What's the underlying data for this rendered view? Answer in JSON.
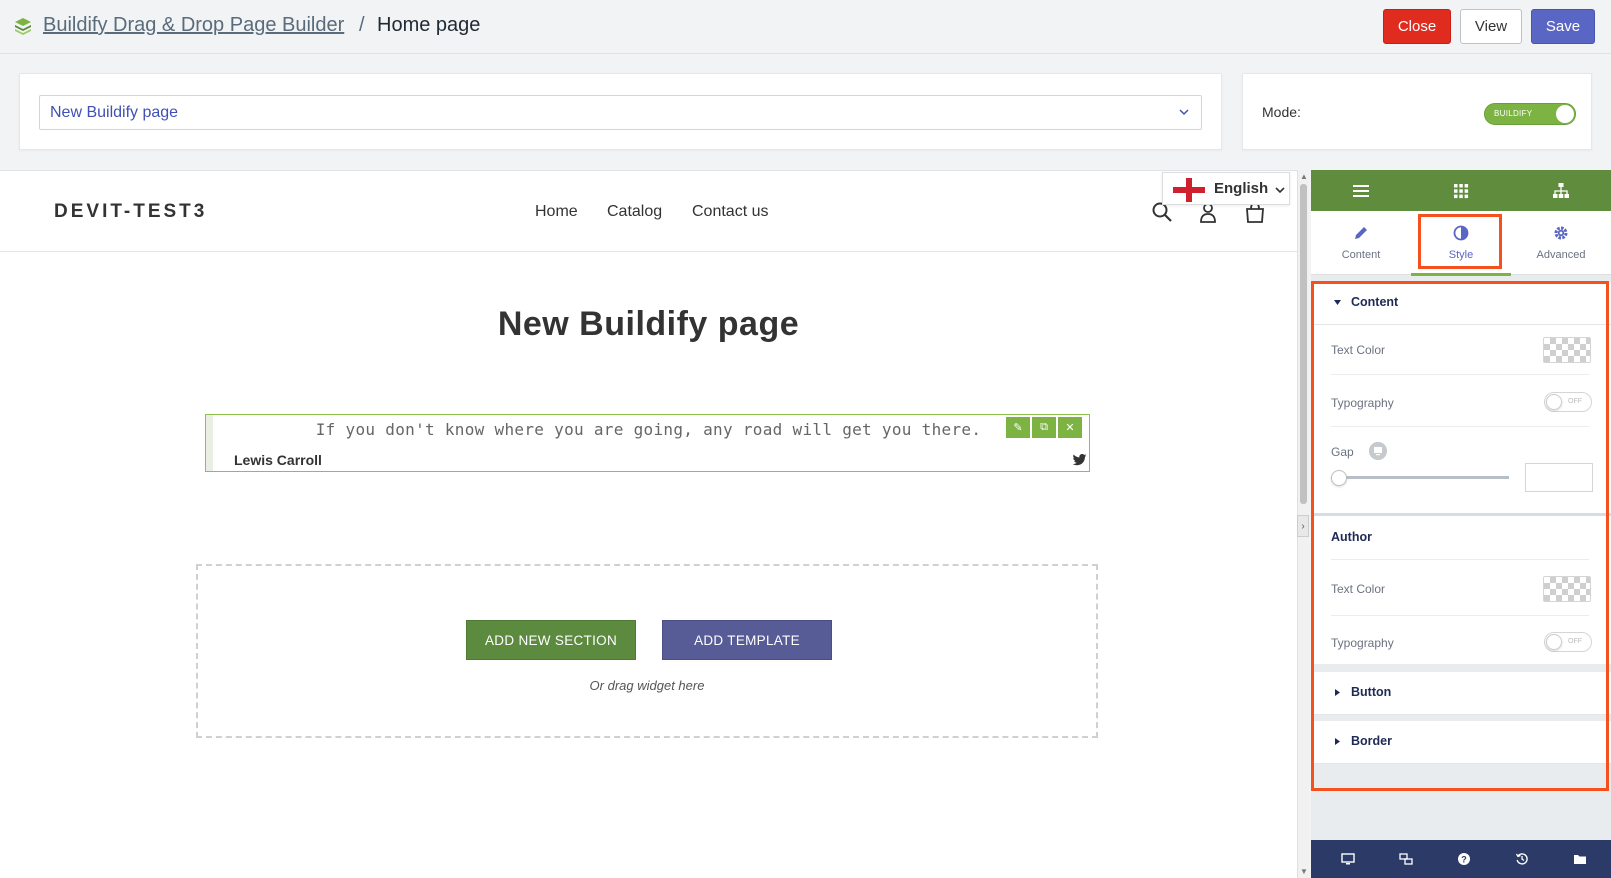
{
  "topbar": {
    "breadcrumb_link": "Buildify Drag & Drop Page Builder",
    "breadcrumb_sep": "/",
    "breadcrumb_current": "Home page",
    "close_label": "Close",
    "view_label": "View",
    "save_label": "Save"
  },
  "page_select": {
    "value": "New Buildify page"
  },
  "mode": {
    "label": "Mode:",
    "toggle_text": "BUILDIFY",
    "on": true
  },
  "site": {
    "brand": "DEVIT-TEST3",
    "nav": [
      "Home",
      "Catalog",
      "Contact us"
    ],
    "language": "English"
  },
  "canvas": {
    "title": "New Buildify page",
    "quote": {
      "text": "If you don't know where you are going, any road will get you there.",
      "author": "Lewis Carroll"
    },
    "dropzone": {
      "add_section": "ADD NEW SECTION",
      "add_template": "ADD TEMPLATE",
      "hint": "Or drag widget here"
    }
  },
  "panel": {
    "tabs": [
      "Content",
      "Style",
      "Advanced"
    ],
    "active_tab": "Style",
    "content_section": {
      "title": "Content",
      "text_color_label": "Text Color",
      "typography_label": "Typography",
      "typography_switch": "OFF",
      "gap_label": "Gap"
    },
    "author_section": {
      "title": "Author",
      "text_color_label": "Text Color",
      "typography_label": "Typography",
      "typography_switch": "OFF"
    },
    "button_section": {
      "title": "Button"
    },
    "border_section": {
      "title": "Border"
    }
  },
  "colors": {
    "accent_green": "#7cb342",
    "panel_green": "#5f8d3d",
    "save_blue": "#5a66c4",
    "close_red": "#e02b1f",
    "highlight": "#f4511e",
    "footer_navy": "#2b3a67"
  }
}
